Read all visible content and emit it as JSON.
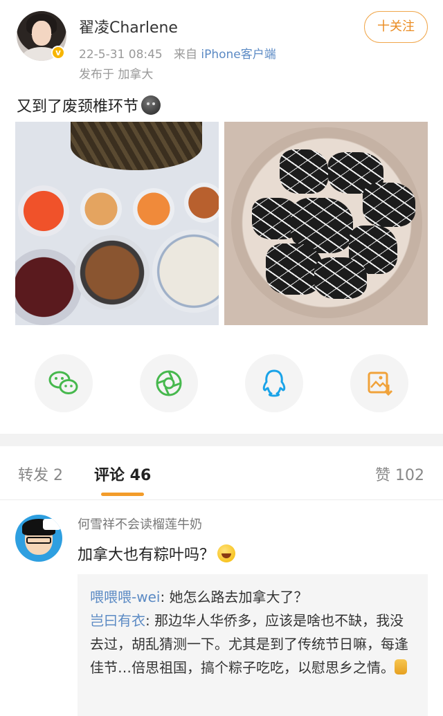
{
  "post": {
    "username": "翟凌Charlene",
    "follow_label": "十关注",
    "timestamp": "22-5-31 08:45",
    "source_prefix": "来自",
    "source_client": "iPhone客户端",
    "location": "发布于 加拿大",
    "text": "又到了废颈椎环节",
    "emoji_icon": "dark-face-emoji-icon"
  },
  "share": {
    "items": [
      {
        "icon": "wechat-icon",
        "color": "#46b84d"
      },
      {
        "icon": "moments-icon",
        "color": "#46b84d"
      },
      {
        "icon": "qq-icon",
        "color": "#1aa3e8"
      },
      {
        "icon": "save-image-icon",
        "color": "#f0a23a"
      }
    ]
  },
  "tabs": {
    "repost": "转发 2",
    "comments": "评论 46",
    "likes": "赞 102"
  },
  "comment": {
    "author": "何雪祥不会读榴莲牛奶",
    "text": "加拿大也有粽叶吗？",
    "replies": [
      {
        "name": "喂喂喂-wei",
        "text": ": 她怎么路去加拿大了？"
      },
      {
        "name": "岂曰有衣",
        "text": ": 那边华人华侨多，应该是啥也不缺，我没去过，胡乱猜测一下。尤其是到了传统节日嘛，每逢佳节…倍思祖国，搞个粽子吃吃，以慰思乡之情。"
      }
    ]
  },
  "colors": {
    "accent": "#f39c2a",
    "link": "#5b8ac4",
    "muted": "#999999"
  }
}
